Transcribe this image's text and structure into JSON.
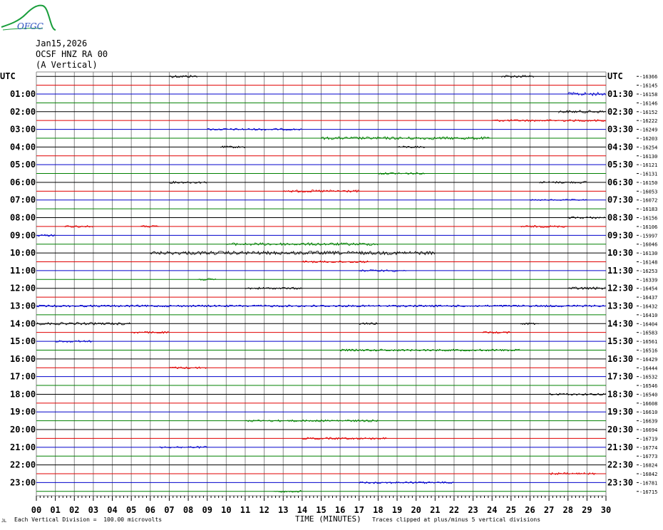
{
  "logo": {
    "text": "OFGC",
    "colors": {
      "swoosh": "#1a9e3c",
      "text": "#2a4fbf"
    }
  },
  "header": {
    "date": "Jan15,2026",
    "station": "OCSF HNZ RA 00",
    "component": "(A Vertical)"
  },
  "utc_label": "UTC",
  "footer": {
    "scale_note": "Each Vertical Division =  100.00 microvolts",
    "xlabel": "TIME (MINUTES)",
    "clip_note": "Traces clipped at plus/minus 5 vertical divisions",
    "corner_mark": "JL"
  },
  "colors": {
    "grid": "#888888",
    "trace_cycle": [
      "#000000",
      "#e00000",
      "#0000cc",
      "#008000"
    ]
  },
  "chart_data": {
    "type": "line",
    "title": "",
    "xlabel": "TIME (MINUTES)",
    "ylabel": "",
    "x_ticks": [
      "00",
      "01",
      "02",
      "03",
      "04",
      "05",
      "06",
      "07",
      "08",
      "09",
      "10",
      "11",
      "12",
      "13",
      "14",
      "15",
      "16",
      "17",
      "18",
      "19",
      "20",
      "21",
      "22",
      "23",
      "24",
      "25",
      "26",
      "27",
      "28",
      "29",
      "30"
    ],
    "xlim": [
      0,
      30
    ],
    "left_labels": [
      "UTC",
      "01:00",
      "02:00",
      "03:00",
      "04:00",
      "05:00",
      "06:00",
      "07:00",
      "08:00",
      "09:00",
      "10:00",
      "11:00",
      "12:00",
      "13:00",
      "14:00",
      "15:00",
      "16:00",
      "17:00",
      "18:00",
      "19:00",
      "20:00",
      "21:00",
      "22:00",
      "23:00"
    ],
    "right_labels": [
      "UTC",
      "01:30",
      "02:30",
      "03:30",
      "04:30",
      "05:30",
      "06:30",
      "07:30",
      "08:30",
      "09:30",
      "10:30",
      "11:30",
      "12:30",
      "13:30",
      "14:30",
      "15:30",
      "16:30",
      "17:30",
      "18:30",
      "19:30",
      "20:30",
      "21:30",
      "22:30",
      "23:30"
    ],
    "offsets": [
      -16366,
      -16145,
      -16158,
      -16146,
      -16152,
      -16222,
      -16249,
      -16203,
      -16254,
      -16130,
      -16121,
      -16131,
      -16150,
      -16053,
      -16072,
      -16183,
      -16156,
      -16106,
      -15997,
      -16046,
      -16130,
      -16148,
      -16253,
      -16339,
      -16454,
      -16437,
      -16432,
      -16410,
      -16404,
      -16583,
      -16561,
      -16516,
      -16429,
      -16444,
      -16532,
      -16546,
      -16540,
      -16608,
      -16610,
      -16639,
      -16694,
      -16719,
      -16774,
      -16773,
      -16824,
      -16842,
      -16781,
      -16715
    ],
    "activity": [
      [
        [
          7,
          8.5,
          2
        ],
        [
          24.5,
          26.2,
          2
        ]
      ],
      [],
      [
        [
          28,
          30,
          2.5
        ]
      ],
      [],
      [
        [
          27.5,
          30,
          2
        ]
      ],
      [
        [
          24,
          30,
          1.5
        ]
      ],
      [
        [
          9,
          14,
          1.5
        ]
      ],
      [
        [
          15,
          24,
          2
        ]
      ],
      [
        [
          9.7,
          11,
          1.5
        ],
        [
          19,
          20.5,
          1.5
        ]
      ],
      [],
      [],
      [
        [
          18,
          20.5,
          1.5
        ]
      ],
      [
        [
          7,
          9,
          1.5
        ],
        [
          26.5,
          29,
          1.5
        ]
      ],
      [
        [
          13,
          17,
          1.8
        ]
      ],
      [
        [
          26,
          29,
          1
        ]
      ],
      [],
      [
        [
          28,
          30,
          1.5
        ]
      ],
      [
        [
          1.5,
          3,
          1.5
        ],
        [
          5.5,
          6.5,
          1.5
        ],
        [
          25.5,
          28,
          1.5
        ]
      ],
      [
        [
          0,
          1,
          1.5
        ]
      ],
      [
        [
          10,
          18,
          2
        ]
      ],
      [
        [
          6,
          21,
          2.5
        ]
      ],
      [
        [
          14,
          17.5,
          1.5
        ]
      ],
      [
        [
          17,
          19.5,
          1.5
        ]
      ],
      [
        [
          8.5,
          9.5,
          1.5
        ]
      ],
      [
        [
          11,
          14,
          1.5
        ],
        [
          28,
          30,
          2
        ]
      ],
      [],
      [
        [
          0,
          30,
          1.5
        ]
      ],
      [],
      [
        [
          0,
          5,
          1.8
        ],
        [
          17,
          18,
          1.5
        ],
        [
          25.5,
          26.5,
          1.5
        ]
      ],
      [
        [
          5,
          7,
          1.5
        ],
        [
          23.5,
          25,
          1.5
        ]
      ],
      [
        [
          1,
          3,
          1.5
        ]
      ],
      [
        [
          16,
          25.5,
          1.5
        ]
      ],
      [],
      [
        [
          7,
          9,
          1.5
        ]
      ],
      [],
      [],
      [
        [
          27,
          30,
          1.5
        ]
      ],
      [],
      [],
      [
        [
          11,
          18,
          1.5
        ]
      ],
      [],
      [
        [
          14,
          18.5,
          1.5
        ]
      ],
      [
        [
          6.5,
          9,
          1.5
        ]
      ],
      [],
      [],
      [
        [
          27,
          29.5,
          1.5
        ]
      ],
      [
        [
          17,
          22,
          1.5
        ]
      ],
      [
        [
          12.5,
          14,
          1.5
        ]
      ]
    ]
  }
}
